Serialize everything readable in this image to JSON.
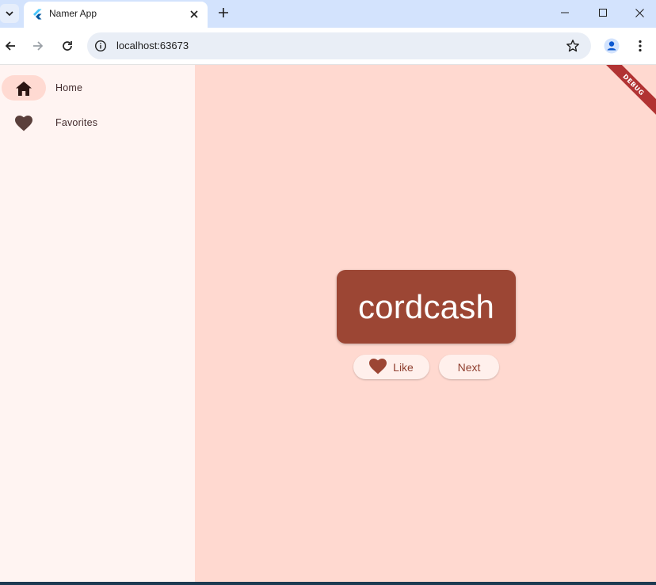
{
  "browser": {
    "tab_title": "Namer App",
    "url": "localhost:63673"
  },
  "icons": {
    "tab_list": "chevron-down-icon",
    "favicon": "flutter-icon",
    "tab_close": "close-icon",
    "new_tab": "plus-icon",
    "back": "back-arrow-icon",
    "forward": "forward-arrow-icon",
    "reload": "reload-icon",
    "site_info": "info-icon",
    "bookmark": "star-icon",
    "profile": "profile-icon",
    "menu": "kebab-menu-icon"
  },
  "sidebar": {
    "items": [
      {
        "label": "Home",
        "icon": "home-icon",
        "selected": true
      },
      {
        "label": "Favorites",
        "icon": "heart-icon",
        "selected": false
      }
    ]
  },
  "main": {
    "word": "cordcash",
    "like_label": "Like",
    "next_label": "Next",
    "debug_label": "DEBUG"
  },
  "colors": {
    "rail_bg": "#fff4f2",
    "main_bg": "#ffd9d0",
    "card_bg": "#9c4634",
    "indicator": "#ffdad2",
    "button_bg": "#fff0ec"
  }
}
